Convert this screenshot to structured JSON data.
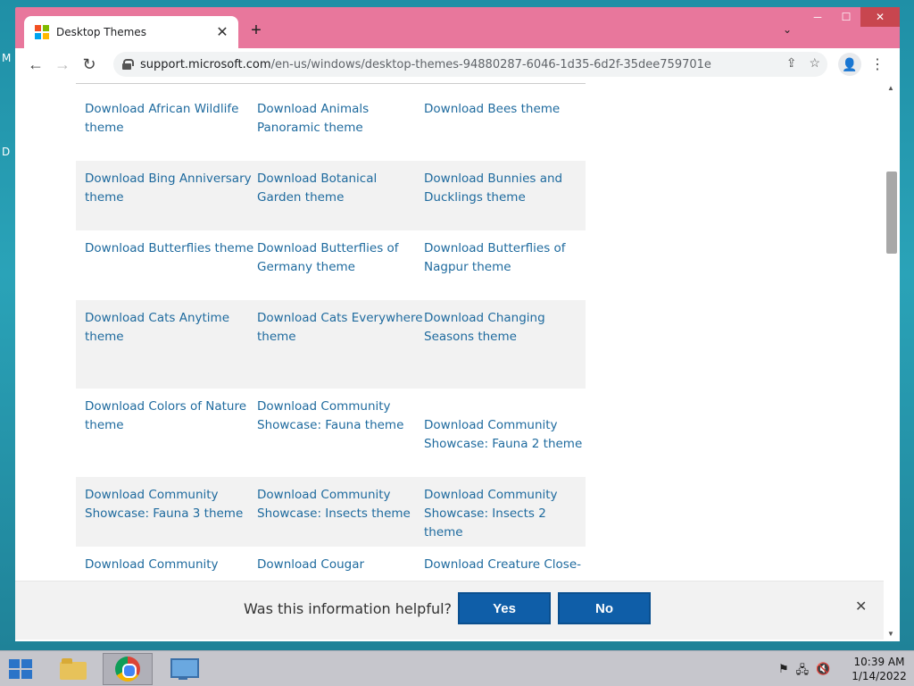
{
  "desktop": {
    "edge_letters": [
      "M",
      "D"
    ]
  },
  "browser": {
    "tab": {
      "title": "Desktop Themes",
      "close_glyph": "✕"
    },
    "new_tab_glyph": "+",
    "tab_search_glyph": "⌄",
    "window_controls": {
      "minimize": "─",
      "maximize": "☐",
      "close": "✕"
    },
    "toolbar": {
      "back_glyph": "←",
      "forward_glyph": "→",
      "reload_glyph": "↻",
      "url_host": "support.microsoft.com",
      "url_path": "/en-us/windows/desktop-themes-94880287-6046-1d35-6d2f-35dee759701e",
      "share_glyph": "⇪",
      "star_glyph": "☆",
      "profile_glyph": "👤",
      "menu_glyph": "⋮"
    }
  },
  "themes": {
    "rows": [
      {
        "shaded": false,
        "cells": [
          "Download African Wildlife theme",
          "Download Animals Panoramic theme",
          "Download Bees theme"
        ]
      },
      {
        "shaded": true,
        "cells": [
          "Download Bing Anniversary theme",
          "Download Botanical Garden theme",
          "Download Bunnies and Ducklings theme"
        ]
      },
      {
        "shaded": false,
        "cells": [
          "Download Butterflies theme",
          "Download Butterflies of Germany theme",
          "Download Butterflies of Nagpur theme"
        ]
      },
      {
        "shaded": true,
        "cells": [
          "Download Cats Anytime theme",
          "Download Cats Everywhere theme",
          "Download Changing Seasons theme"
        ]
      },
      {
        "shaded": false,
        "cells": [
          "Download Colors of Nature theme",
          "Download Community Showcase: Fauna theme",
          "Download Community Showcase: Fauna 2 theme"
        ]
      },
      {
        "shaded": true,
        "cells": [
          "Download Community Showcase: Fauna 3 theme",
          "Download Community Showcase: Insects theme",
          "Download Community Showcase: Insects 2 theme"
        ]
      },
      {
        "shaded": false,
        "cells": [
          "Download Community",
          "Download Cougar",
          "Download Creature Close-"
        ]
      }
    ]
  },
  "feedback": {
    "question": "Was this information helpful?",
    "yes_label": "Yes",
    "no_label": "No",
    "close_glyph": "✕"
  },
  "scrollbar": {
    "up_glyph": "▲",
    "down_glyph": "▼"
  },
  "taskbar": {
    "items": [
      "file-explorer",
      "chrome",
      "control-panel"
    ],
    "tray_glyphs": [
      "⚑",
      "🖧",
      "🔇"
    ],
    "time": "10:39 AM",
    "date": "1/14/2022"
  },
  "colors": {
    "window_frame": "#e8779c",
    "link": "#1e6a9e",
    "button_blue": "#0f5ea8",
    "ms_logo": [
      "#f25022",
      "#7fba00",
      "#00a4ef",
      "#ffb900"
    ]
  }
}
